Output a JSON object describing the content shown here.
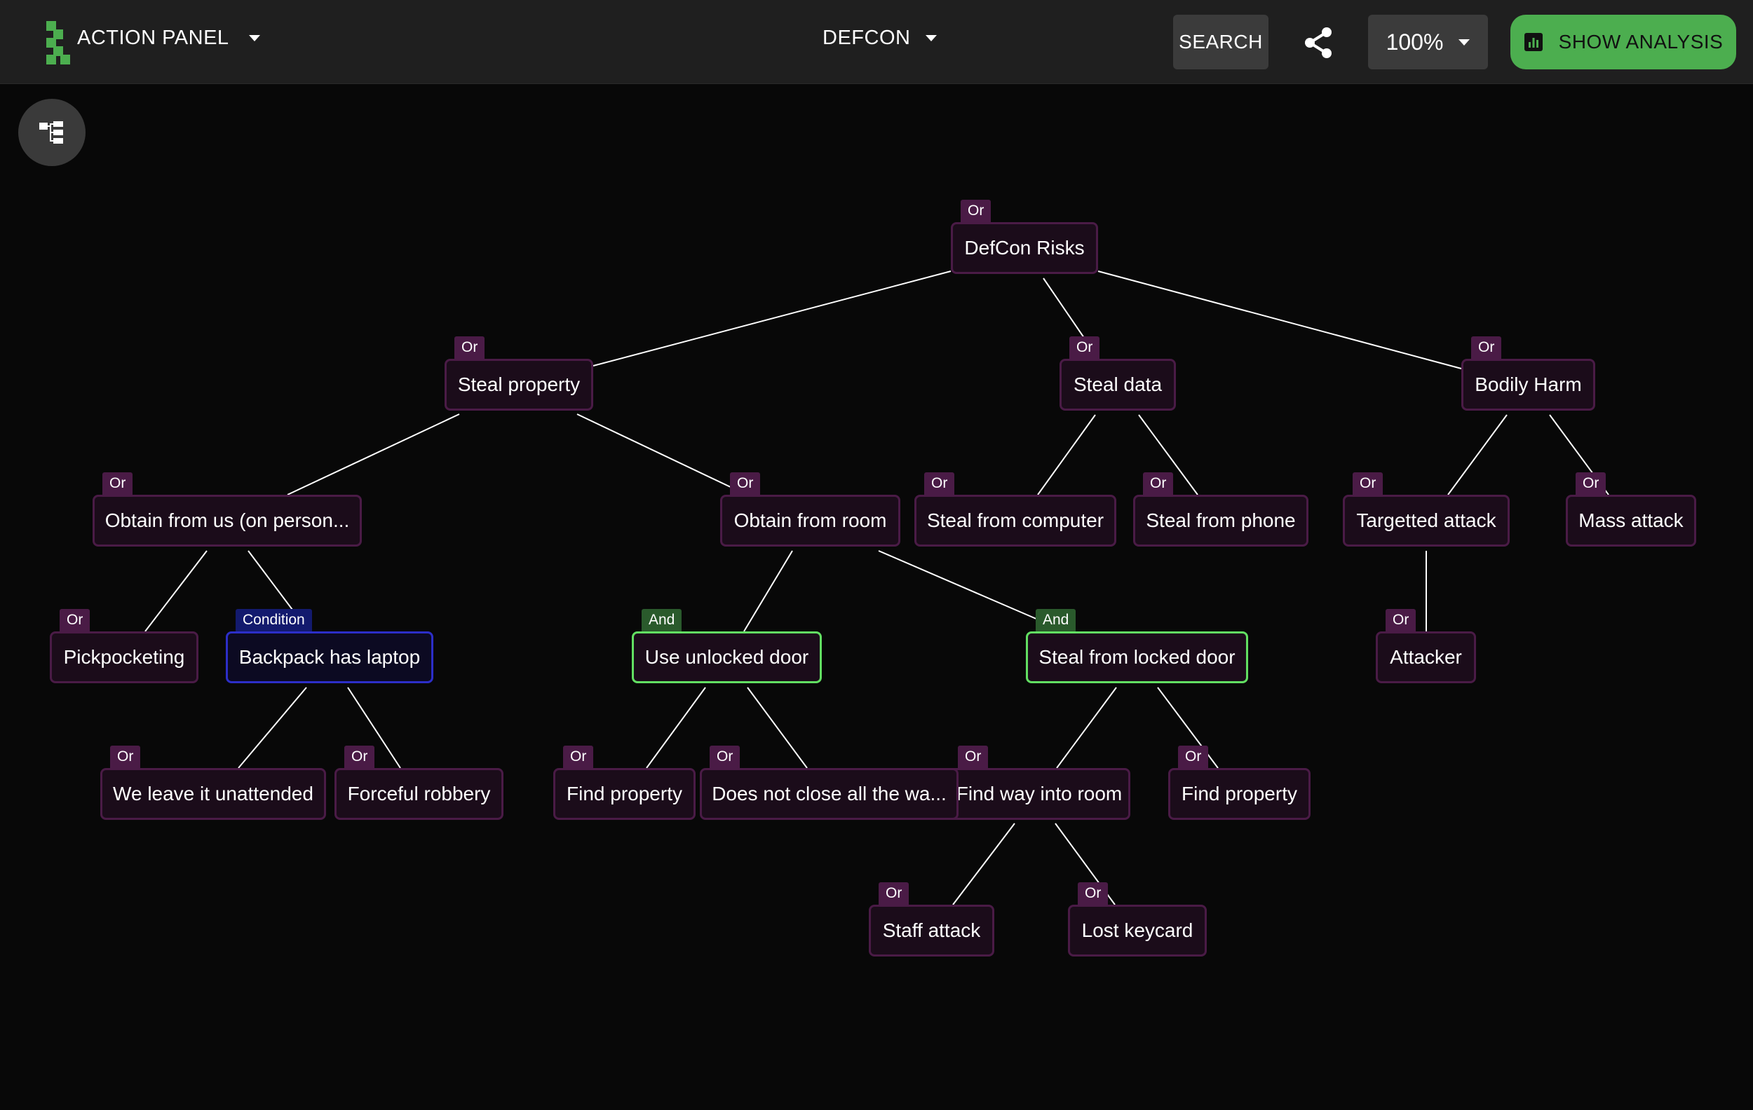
{
  "header": {
    "action_panel_label": "ACTION PANEL",
    "project_label": "DEFCON",
    "search_label": "SEARCH",
    "zoom_label": "100%",
    "analysis_label": "SHOW ANALYSIS"
  },
  "tree": {
    "nodes": {
      "defcon_risks": {
        "label": "DefCon Risks",
        "gate": "Or"
      },
      "steal_property": {
        "label": "Steal property",
        "gate": "Or"
      },
      "steal_data": {
        "label": "Steal data",
        "gate": "Or"
      },
      "bodily_harm": {
        "label": "Bodily Harm",
        "gate": "Or"
      },
      "obtain_from_us": {
        "label": "Obtain from us (on person...",
        "gate": "Or"
      },
      "obtain_from_room": {
        "label": "Obtain from room",
        "gate": "Or"
      },
      "steal_from_computer": {
        "label": "Steal from computer",
        "gate": "Or"
      },
      "steal_from_phone": {
        "label": "Steal from phone",
        "gate": "Or"
      },
      "targetted_attack": {
        "label": "Targetted attack",
        "gate": "Or"
      },
      "mass_attack": {
        "label": "Mass attack",
        "gate": "Or"
      },
      "pickpocketing": {
        "label": "Pickpocketing",
        "gate": "Or"
      },
      "backpack_laptop": {
        "label": "Backpack has laptop",
        "gate": "Condition"
      },
      "use_unlocked_door": {
        "label": "Use unlocked door",
        "gate": "And"
      },
      "steal_locked_door": {
        "label": "Steal from locked door",
        "gate": "And"
      },
      "attacker": {
        "label": "Attacker",
        "gate": "Or"
      },
      "leave_unattended": {
        "label": "We leave it unattended",
        "gate": "Or"
      },
      "forceful_robbery": {
        "label": "Forceful robbery",
        "gate": "Or"
      },
      "find_property_1": {
        "label": "Find property",
        "gate": "Or"
      },
      "does_not_close": {
        "label": "Does not close all the wa...",
        "gate": "Or"
      },
      "find_way_into_room": {
        "label": "Find way into room",
        "gate": "Or"
      },
      "find_property_2": {
        "label": "Find property",
        "gate": "Or"
      },
      "staff_attack": {
        "label": "Staff attack",
        "gate": "Or"
      },
      "lost_keycard": {
        "label": "Lost keycard",
        "gate": "Or"
      }
    }
  },
  "colors": {
    "background": "#080808",
    "topbar": "#1f1f1f",
    "node_border": "#4a1b46",
    "and_border": "#62df62",
    "condition_border": "#2c2ec8",
    "accent_green": "#4cae4f"
  }
}
